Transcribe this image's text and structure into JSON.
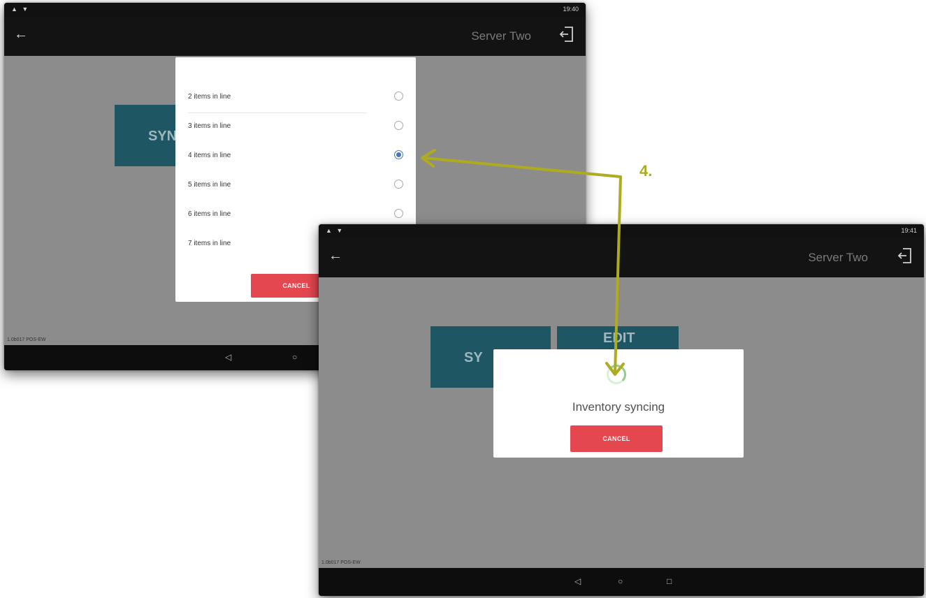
{
  "annotation": {
    "step_label": "4.",
    "color": "#adab1f"
  },
  "screen1": {
    "status_time": "19:40",
    "app_title": "Server Two",
    "tile_label": "SYN",
    "version_text": "1.0b017 POS-EW",
    "dialog": {
      "options": [
        {
          "label": "2 items in line",
          "selected": false
        },
        {
          "label": "3 items in line",
          "selected": false
        },
        {
          "label": "4 items in line",
          "selected": true
        },
        {
          "label": "5 items in line",
          "selected": false
        },
        {
          "label": "6 items in line",
          "selected": false
        },
        {
          "label": "7 items in line",
          "selected": false
        }
      ],
      "cancel_label": "CANCEL"
    }
  },
  "screen2": {
    "status_time": "19:41",
    "app_title": "Server Two",
    "tile_sync_label": "SY",
    "tile_edit_label": "EDIT",
    "version_text": "1.0b017 POS-EW",
    "dialog": {
      "message": "Inventory syncing",
      "cancel_label": "CANCEL"
    }
  },
  "colors": {
    "accent_red": "#e5474f",
    "tile_teal": "#1e5663",
    "radio_blue": "#4a78b6",
    "spinner_green": "#8fce8b"
  }
}
